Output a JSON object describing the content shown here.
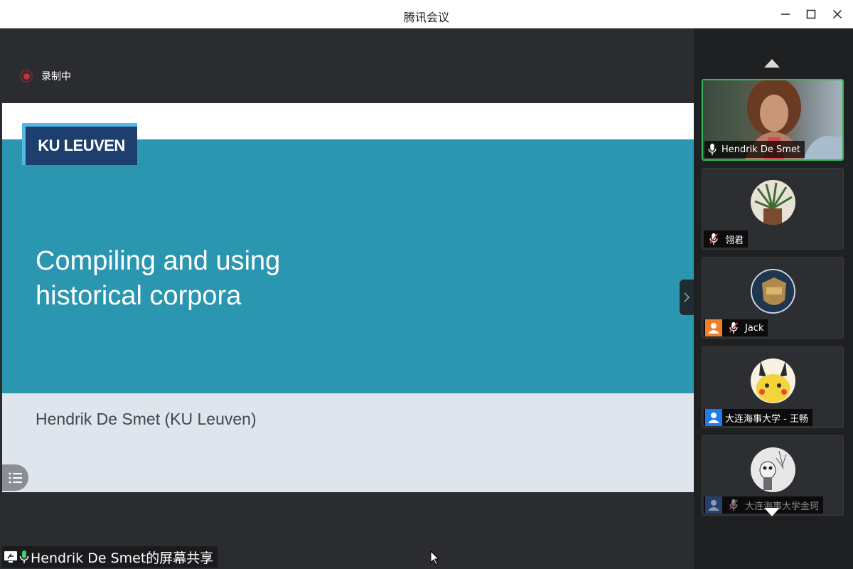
{
  "window": {
    "title": "腾讯会议",
    "controls": [
      "minimize-icon",
      "maximize-icon",
      "close-icon"
    ]
  },
  "recording": {
    "label": "录制中",
    "color": "#c0333b"
  },
  "slide": {
    "logo_text": "KU LEUVEN",
    "title_line1": "Compiling and using",
    "title_line2": "historical corpora",
    "author": "Hendrik De Smet (KU Leuven)",
    "colors": {
      "band": "#2a96b0",
      "footer": "#dfe5ec",
      "logo": "#1d3f6e"
    }
  },
  "share_bar": {
    "label": "Hendrik De Smet的屏幕共享"
  },
  "participants": [
    {
      "name": "Hendrik De Smet",
      "mic": "on",
      "video": true,
      "active_speaker": true
    },
    {
      "name": "翎君",
      "mic": "muted"
    },
    {
      "name": "Jack",
      "mic": "muted",
      "badge": "orange-user"
    },
    {
      "name": "大连海事大学 - 王畅",
      "mic": "none",
      "badge": "blue-user"
    },
    {
      "name": "大连海事大学金珂",
      "mic": "muted",
      "badge": "blue-user"
    }
  ],
  "colors": {
    "accent_green": "#35b85a",
    "sidebar_bg": "#1f2022"
  }
}
